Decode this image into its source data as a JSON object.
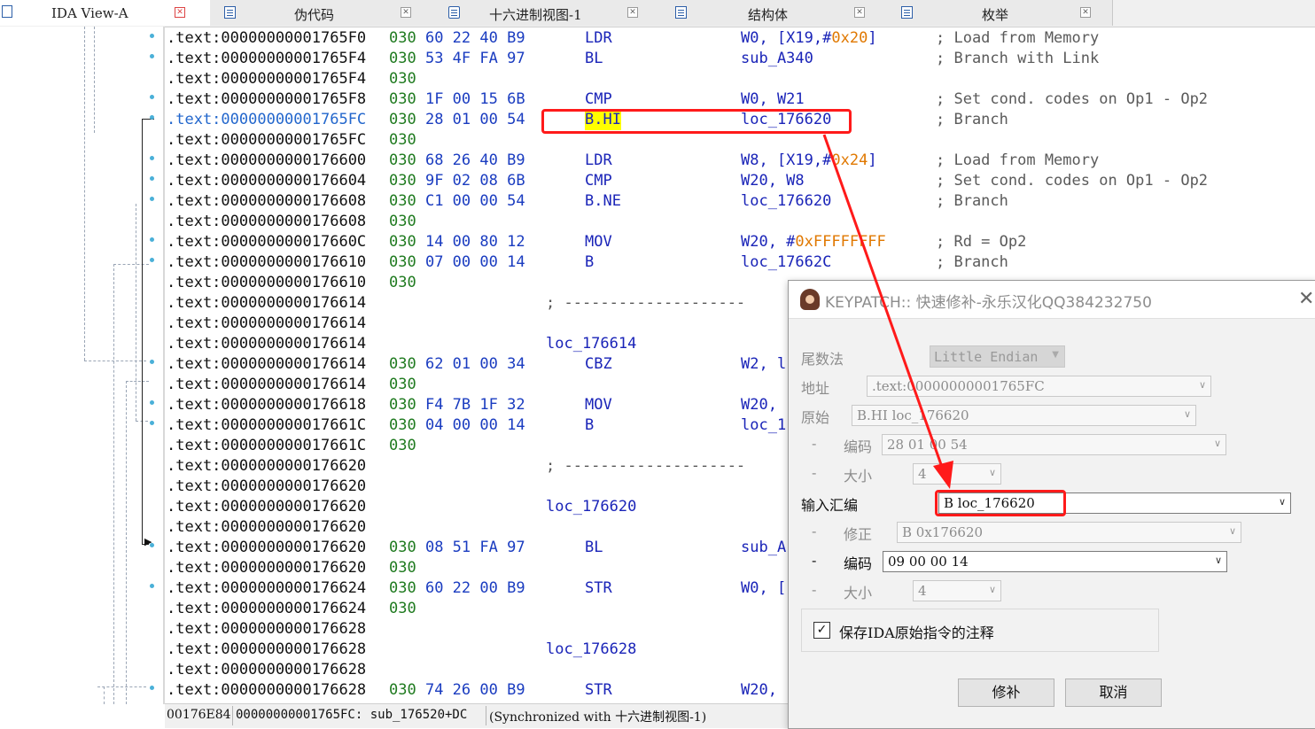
{
  "tabs": [
    {
      "label": "IDA View-A",
      "active": true,
      "icon": "ida-view-icon"
    },
    {
      "label": "伪代码",
      "active": false,
      "icon": "pseudocode-icon"
    },
    {
      "label": "十六进制视图-1",
      "active": false,
      "icon": "hex-view-icon"
    },
    {
      "label": "结构体",
      "active": false,
      "icon": "structures-icon"
    },
    {
      "label": "枚举",
      "active": false,
      "icon": "enums-icon"
    }
  ],
  "listing": [
    {
      "addr": ".text:00000000001765F0",
      "b1": "030",
      "b2": "60 22 40 B9",
      "mnem": "LDR",
      "ops_a": "W0, [X19,#",
      "ops_imm": "0x20",
      "ops_b": "]",
      "cmt": "; Load from Memory"
    },
    {
      "addr": ".text:00000000001765F4",
      "b1": "030",
      "b2": "53 4F FA 97",
      "mnem": "BL",
      "ops_a": "sub_A340",
      "ops_imm": "",
      "ops_b": "",
      "cmt": "; Branch with Link"
    },
    {
      "addr": ".text:00000000001765F4",
      "b1": "030",
      "b2": "",
      "mnem": "",
      "ops_a": "",
      "ops_imm": "",
      "ops_b": "",
      "cmt": ""
    },
    {
      "addr": ".text:00000000001765F8",
      "b1": "030",
      "b2": "1F 00 15 6B",
      "mnem": "CMP",
      "ops_a": "W0, W21",
      "ops_imm": "",
      "ops_b": "",
      "cmt": "; Set cond. codes on Op1 - Op2"
    },
    {
      "addr": ".text:00000000001765FC",
      "b1": "030",
      "b2": "28 01 00 54",
      "mnem": "B.HI",
      "ops_a": "loc_176620",
      "ops_imm": "",
      "ops_b": "",
      "cmt": "; Branch",
      "selected": true
    },
    {
      "addr": ".text:00000000001765FC",
      "b1": "030",
      "b2": "",
      "mnem": "",
      "ops_a": "",
      "ops_imm": "",
      "ops_b": "",
      "cmt": ""
    },
    {
      "addr": ".text:0000000000176600",
      "b1": "030",
      "b2": "68 26 40 B9",
      "mnem": "LDR",
      "ops_a": "W8, [X19,#",
      "ops_imm": "0x24",
      "ops_b": "]",
      "cmt": "; Load from Memory"
    },
    {
      "addr": ".text:0000000000176604",
      "b1": "030",
      "b2": "9F 02 08 6B",
      "mnem": "CMP",
      "ops_a": "W20, W8",
      "ops_imm": "",
      "ops_b": "",
      "cmt": "; Set cond. codes on Op1 - Op2"
    },
    {
      "addr": ".text:0000000000176608",
      "b1": "030",
      "b2": "C1 00 00 54",
      "mnem": "B.NE",
      "ops_a": "loc_176620",
      "ops_imm": "",
      "ops_b": "",
      "cmt": "; Branch"
    },
    {
      "addr": ".text:0000000000176608",
      "b1": "030",
      "b2": "",
      "mnem": "",
      "ops_a": "",
      "ops_imm": "",
      "ops_b": "",
      "cmt": ""
    },
    {
      "addr": ".text:000000000017660C",
      "b1": "030",
      "b2": "14 00 80 12",
      "mnem": "MOV",
      "ops_a": "W20, #",
      "ops_imm": "0xFFFFFFFF",
      "ops_b": "",
      "cmt": "; Rd = Op2"
    },
    {
      "addr": ".text:0000000000176610",
      "b1": "030",
      "b2": "07 00 00 14",
      "mnem": "B",
      "ops_a": "loc_17662C",
      "ops_imm": "",
      "ops_b": "",
      "cmt": "; Branch"
    },
    {
      "addr": ".text:0000000000176610",
      "b1": "030",
      "b2": "",
      "mnem": "",
      "ops_a": "",
      "ops_imm": "",
      "ops_b": "",
      "cmt": ""
    },
    {
      "addr": ".text:0000000000176614",
      "b1": "",
      "b2": "",
      "sep": "; --------------------",
      "mnem": "",
      "ops_a": "",
      "ops_imm": "",
      "ops_b": "",
      "cmt": ""
    },
    {
      "addr": ".text:0000000000176614",
      "b1": "",
      "b2": "",
      "mnem": "",
      "ops_a": "",
      "ops_imm": "",
      "ops_b": "",
      "cmt": ""
    },
    {
      "addr": ".text:0000000000176614",
      "b1": "",
      "b2": "",
      "label": "loc_176614",
      "mnem": "",
      "ops_a": "",
      "ops_imm": "",
      "ops_b": "",
      "cmt": ""
    },
    {
      "addr": ".text:0000000000176614",
      "b1": "030",
      "b2": "62 01 00 34",
      "mnem": "CBZ",
      "ops_a": "W2, l",
      "ops_imm": "",
      "ops_b": "",
      "cmt": ""
    },
    {
      "addr": ".text:0000000000176614",
      "b1": "030",
      "b2": "",
      "mnem": "",
      "ops_a": "",
      "ops_imm": "",
      "ops_b": "",
      "cmt": ""
    },
    {
      "addr": ".text:0000000000176618",
      "b1": "030",
      "b2": "F4 7B 1F 32",
      "mnem": "MOV",
      "ops_a": "W20,",
      "ops_imm": "",
      "ops_b": "",
      "cmt": ""
    },
    {
      "addr": ".text:000000000017661C",
      "b1": "030",
      "b2": "04 00 00 14",
      "mnem": "B",
      "ops_a": "loc_1",
      "ops_imm": "",
      "ops_b": "",
      "cmt": ""
    },
    {
      "addr": ".text:000000000017661C",
      "b1": "030",
      "b2": "",
      "mnem": "",
      "ops_a": "",
      "ops_imm": "",
      "ops_b": "",
      "cmt": ""
    },
    {
      "addr": ".text:0000000000176620",
      "b1": "",
      "b2": "",
      "sep": "; --------------------",
      "mnem": "",
      "ops_a": "",
      "ops_imm": "",
      "ops_b": "",
      "cmt": ""
    },
    {
      "addr": ".text:0000000000176620",
      "b1": "",
      "b2": "",
      "mnem": "",
      "ops_a": "",
      "ops_imm": "",
      "ops_b": "",
      "cmt": ""
    },
    {
      "addr": ".text:0000000000176620",
      "b1": "",
      "b2": "",
      "label": "loc_176620",
      "mnem": "",
      "ops_a": "",
      "ops_imm": "",
      "ops_b": "",
      "cmt": ""
    },
    {
      "addr": ".text:0000000000176620",
      "b1": "",
      "b2": "",
      "mnem": "",
      "ops_a": "",
      "ops_imm": "",
      "ops_b": "",
      "cmt": ""
    },
    {
      "addr": ".text:0000000000176620",
      "b1": "030",
      "b2": "08 51 FA 97",
      "mnem": "BL",
      "ops_a": "sub_A",
      "ops_imm": "",
      "ops_b": "",
      "cmt": ""
    },
    {
      "addr": ".text:0000000000176620",
      "b1": "030",
      "b2": "",
      "mnem": "",
      "ops_a": "",
      "ops_imm": "",
      "ops_b": "",
      "cmt": ""
    },
    {
      "addr": ".text:0000000000176624",
      "b1": "030",
      "b2": "60 22 00 B9",
      "mnem": "STR",
      "ops_a": "W0, [",
      "ops_imm": "",
      "ops_b": "",
      "cmt": ""
    },
    {
      "addr": ".text:0000000000176624",
      "b1": "030",
      "b2": "",
      "mnem": "",
      "ops_a": "",
      "ops_imm": "",
      "ops_b": "",
      "cmt": ""
    },
    {
      "addr": ".text:0000000000176628",
      "b1": "",
      "b2": "",
      "mnem": "",
      "ops_a": "",
      "ops_imm": "",
      "ops_b": "",
      "cmt": ""
    },
    {
      "addr": ".text:0000000000176628",
      "b1": "",
      "b2": "",
      "label": "loc_176628",
      "mnem": "",
      "ops_a": "",
      "ops_imm": "",
      "ops_b": "",
      "cmt": ""
    },
    {
      "addr": ".text:0000000000176628",
      "b1": "",
      "b2": "",
      "mnem": "",
      "ops_a": "",
      "ops_imm": "",
      "ops_b": "",
      "cmt": ""
    },
    {
      "addr": ".text:0000000000176628",
      "b1": "030",
      "b2": "74 26 00 B9",
      "mnem": "STR",
      "ops_a": "W20,",
      "ops_imm": "",
      "ops_b": "",
      "cmt": ""
    }
  ],
  "statusbar": {
    "offset": "00176E84",
    "location": "00000000001765FC: sub_176520+DC",
    "sync": "(Synchronized with 十六进制视图-1)"
  },
  "dialog": {
    "title": "KEYPATCH:: 快速修补-永乐汉化QQ384232750",
    "endian_label": "尾数法",
    "endian_value": "Little Endian",
    "address_label": "地址",
    "address_value": ".text:00000000001765FC",
    "original_label": "原始",
    "original_value": "B.HI loc_176620",
    "orig_encoding_label": "编码",
    "orig_encoding_value": "28 01 00 54",
    "orig_size_label": "大小",
    "orig_size_value": "4",
    "input_label": "输入汇编",
    "input_value": "B loc_176620",
    "fixup_label": "修正",
    "fixup_value": "B 0x176620",
    "new_encoding_label": "编码",
    "new_encoding_value": "09 00 00 14",
    "new_size_label": "大小",
    "new_size_value": "4",
    "dash": "-",
    "keep_comment_label": "保存IDA原始指令的注释",
    "keep_comment_checked": true,
    "patch_button": "修补",
    "cancel_button": "取消"
  },
  "colors": {
    "address": "#111111",
    "selected_address": "#2266cc",
    "opcode_bytes": "#1a3cc0",
    "segment_bytes": "#1f7a1f",
    "mnemonic": "#1a24b8",
    "immediate": "#e07800",
    "comment": "#5a5a5a",
    "highlight": "#ffff00",
    "annotation_red": "#ff1a1a"
  }
}
